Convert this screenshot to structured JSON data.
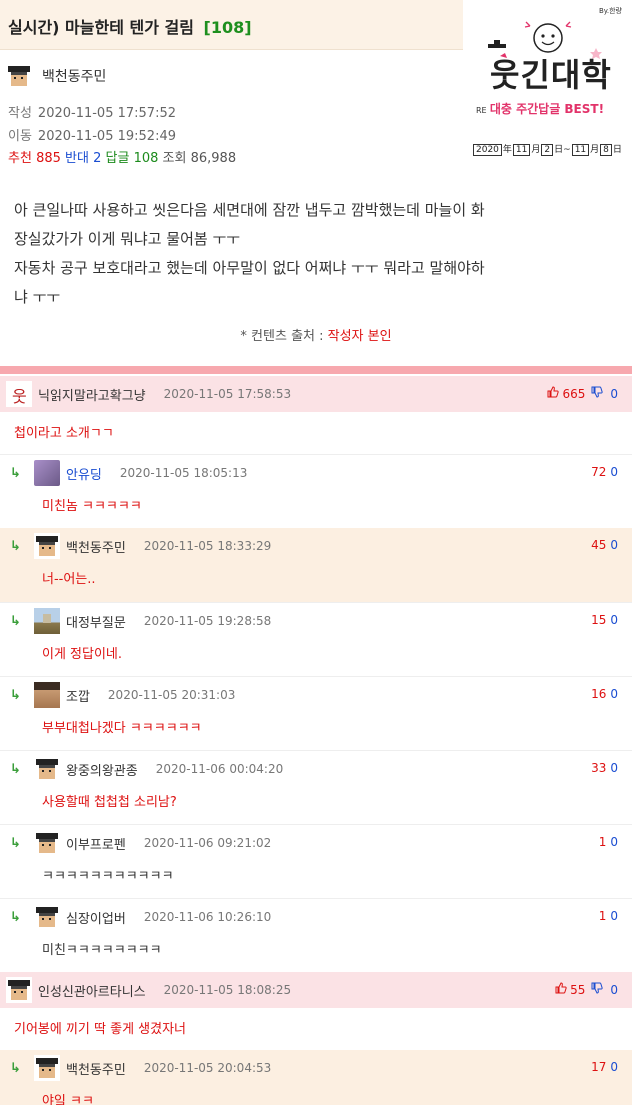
{
  "post": {
    "title": "실시간) 마늘한테 텐가 걸림",
    "comment_count": "[108]",
    "author": "백천동주민",
    "written_label": "작성",
    "written": "2020-11-05 17:57:52",
    "moved_label": "이동",
    "moved": "2020-11-05 19:52:49",
    "stats": {
      "rec_label": "추천",
      "rec": "885",
      "opp_label": "반대",
      "opp": "2",
      "reply_label": "답글",
      "reply": "108",
      "view_label": "조회",
      "view": "86,988"
    },
    "body": [
      "아 큰일나따 사용하고 씻은다음 세면대에 잠깐 냅두고 깜박했는데 마늘이 화",
      "장실갔가가 이게 뭐냐고 물어봄 ㅜㅜ",
      "자동차 공구 보호대라고 했는데 아무말이 없다 어쩌냐 ㅜㅜ 뭐라고 말해야하",
      "냐 ㅜㅜ"
    ],
    "source_label": "* 컨텐츠 출처 :",
    "source_value": "작성자 본인"
  },
  "logo": {
    "tiny": "By.한량",
    "main": "웃긴대학",
    "sub_prefix": "RE",
    "sub": "대충 주간답글 BEST!",
    "range_year": "2020",
    "range_start_m": "11",
    "range_start_d": "2",
    "range_end_m": "11",
    "range_end_d": "8",
    "range_y_label": "年",
    "range_m_label": "月",
    "range_d_label": "日",
    "range_sep": "~"
  },
  "comments": [
    {
      "id": "c1",
      "level": "top",
      "author_style": false,
      "avatar": "stick",
      "nick": "닉읽지말라고확그냥",
      "date": "2020-11-05 17:58:53",
      "up": "665",
      "down": "0",
      "thumbs": true,
      "body": "첩이라고 소개ㄱㄱ"
    },
    {
      "id": "c2",
      "level": "reply",
      "author_style": false,
      "avatar": "photo",
      "nick": "안유딩",
      "date": "2020-11-05 18:05:13",
      "up": "72",
      "down": "0",
      "thumbs": false,
      "body": "미친놈 ㅋㅋㅋㅋㅋ"
    },
    {
      "id": "c3",
      "level": "reply",
      "author_style": true,
      "avatar": "default",
      "nick": "백천동주민",
      "date": "2020-11-05 18:33:29",
      "up": "45",
      "down": "0",
      "thumbs": false,
      "body": "너--어는.."
    },
    {
      "id": "c4",
      "level": "reply",
      "author_style": false,
      "avatar": "landscape",
      "nick": "대정부질문",
      "date": "2020-11-05 19:28:58",
      "up": "15",
      "down": "0",
      "thumbs": false,
      "body": "이게 정답이네."
    },
    {
      "id": "c5",
      "level": "reply",
      "author_style": false,
      "avatar": "face",
      "nick": "조깝",
      "date": "2020-11-05 20:31:03",
      "up": "16",
      "down": "0",
      "thumbs": false,
      "body": "부부대첩나겠다 ㅋㅋㅋㅋㅋㅋ"
    },
    {
      "id": "c6",
      "level": "reply",
      "author_style": false,
      "avatar": "default",
      "nick": "왕중의왕관종",
      "date": "2020-11-06 00:04:20",
      "up": "33",
      "down": "0",
      "thumbs": false,
      "body": "사용할때 첩첩첩 소리남?"
    },
    {
      "id": "c7",
      "level": "reply",
      "author_style": false,
      "avatar": "default",
      "nick": "이부프로펜",
      "date": "2020-11-06 09:21:02",
      "up": "1",
      "down": "0",
      "thumbs": false,
      "body": "ㅋㅋㅋㅋㅋㅋㅋㅋㅋㅋㅋ"
    },
    {
      "id": "c8",
      "level": "reply",
      "author_style": false,
      "avatar": "default",
      "nick": "심장이업버",
      "date": "2020-11-06 10:26:10",
      "up": "1",
      "down": "0",
      "thumbs": false,
      "body": "미친ㅋㅋㅋㅋㅋㅋㅋㅋ"
    },
    {
      "id": "c9",
      "level": "top",
      "author_style": false,
      "avatar": "default",
      "nick": "인성신관아르타니스",
      "date": "2020-11-05 18:08:25",
      "up": "55",
      "down": "0",
      "thumbs": true,
      "body": "기어봉에 끼기 딱 좋게 생겼자너"
    },
    {
      "id": "c10",
      "level": "reply",
      "author_style": true,
      "avatar": "default",
      "nick": "백천동주민",
      "date": "2020-11-05 20:04:53",
      "up": "17",
      "down": "0",
      "thumbs": false,
      "body": "야잌 ㅋㅋ"
    }
  ],
  "icons": {
    "reply_arrow": "↳",
    "thumb_up": "👍",
    "thumb_down": "👎"
  },
  "colors": {
    "title_bg": "#fcf2e6",
    "comment_top_bg": "#fbe2e5",
    "author_reply_bg": "#fcefe1",
    "divider": "#f7a8ae",
    "recommend": "#dd1111",
    "oppose": "#1a4dd1",
    "reply_count": "#1d8b1d"
  }
}
